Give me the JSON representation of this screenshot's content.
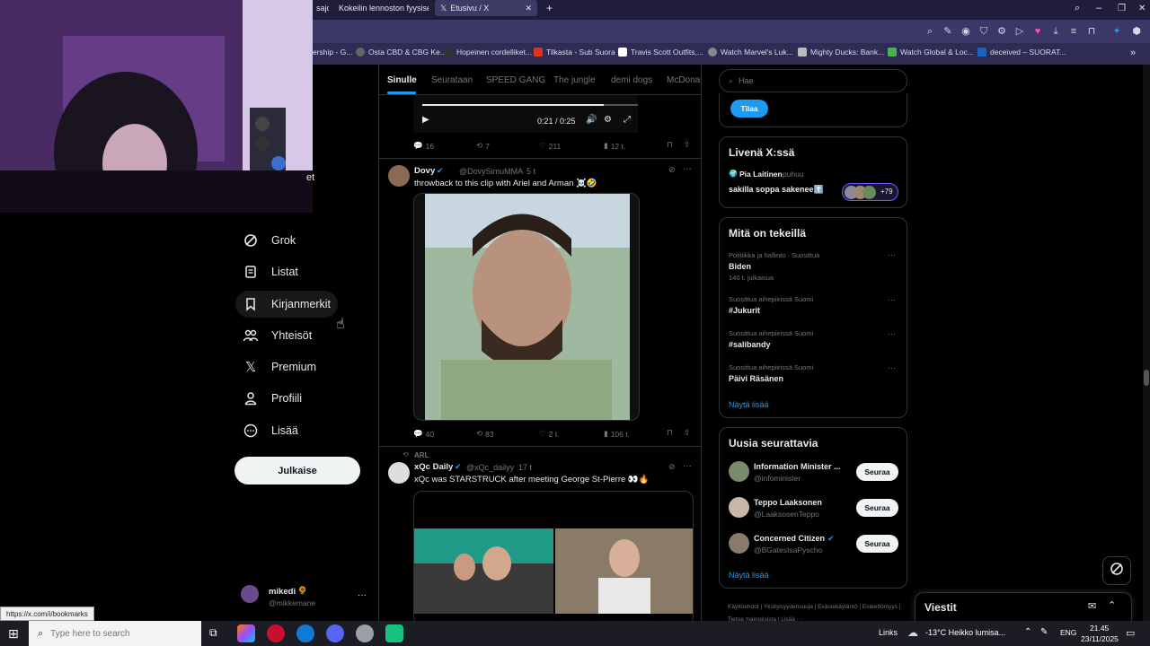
{
  "browser": {
    "tabs": [
      {
        "label": "sajo"
      },
      {
        "label": "Kokeilin lennoston fyysise"
      },
      {
        "label": "Etusivu / X"
      }
    ],
    "bookmarks": [
      "ership - G...",
      "Osta CBD & CBG Ke...",
      "Hopeinen cordelliket...",
      "Tilkasta - Sub Suora",
      "Travis Scott Outfits,...",
      "Watch Marvel's Luk...",
      "Mighty Ducks: Bank...",
      "Watch Global & Loc...",
      "deceived – SUORAT..."
    ]
  },
  "nav": {
    "partial_top": "et",
    "items": [
      {
        "label": "Grok",
        "icon": "grok-icon"
      },
      {
        "label": "Listat",
        "icon": "list-icon"
      },
      {
        "label": "Kirjanmerkit",
        "icon": "bookmark-icon"
      },
      {
        "label": "Yhteisöt",
        "icon": "communities-icon"
      },
      {
        "label": "Premium",
        "icon": "x-logo-icon"
      },
      {
        "label": "Profiili",
        "icon": "profile-icon"
      },
      {
        "label": "Lisää",
        "icon": "more-circle-icon"
      }
    ],
    "post_button": "Julkaise",
    "account": {
      "name": "mikedi",
      "handle": "@mikkemane"
    },
    "status_url": "https://x.com/i/bookmarks"
  },
  "feed": {
    "tabs": [
      "Sinulle",
      "Seurataan",
      "SPEED GANG",
      "The jungle",
      "demi dogs",
      "McDonal"
    ],
    "video_time": "0:21 / 0:25",
    "tweet0_actions": {
      "replies": "16",
      "reposts": "7",
      "likes": "211",
      "views": "12 t."
    },
    "tweet1": {
      "name": "Dovy",
      "handle": "@DovySimuMMA",
      "time": "5 t",
      "text": "throwback to this clip with Ariel and Arman ☠️🤣",
      "replies": "40",
      "reposts": "83",
      "likes": "2 t.",
      "views": "106 t."
    },
    "tweet2": {
      "reposted_by": "ARL",
      "name": "xQc Daily",
      "handle": "@xQc_dailyy",
      "time": "17 t",
      "text": "xQc was STARSTRUCK after meeting George St-Pierre 👀🔥"
    }
  },
  "right": {
    "search_placeholder": "Hae",
    "subscribe_button": "Tilaa",
    "live": {
      "title": "Livenä X:ssä",
      "host": "Pia Laitinen",
      "host_suffix": "puhuu",
      "stream_title": "sakilla soppa sakenee⬆️",
      "count": "+79"
    },
    "trends": {
      "title": "Mitä on tekeillä",
      "items": [
        {
          "category": "Politiikka ja hallinto · Suosittua",
          "name": "Biden",
          "posts": "140 t. julkaisua"
        },
        {
          "category": "Suosittua aihepiirissä Suomi",
          "name": "#Jukurit",
          "posts": ""
        },
        {
          "category": "Suosittua aihepiirissä Suomi",
          "name": "#salibandy",
          "posts": ""
        },
        {
          "category": "Suosittua aihepiirissä Suomi",
          "name": "Päivi Räsänen",
          "posts": ""
        }
      ],
      "show_more": "Näytä lisää"
    },
    "follow": {
      "title": "Uusia seurattavia",
      "items": [
        {
          "name": "Information Minister ...",
          "handle": "@infominister"
        },
        {
          "name": "Teppo Laaksonen",
          "handle": "@LaaksosenTeppo"
        },
        {
          "name": "Concerned Citizen",
          "handle": "@BGatesIsaPyscho"
        }
      ],
      "button": "Seuraa",
      "show_more": "Näytä lisää"
    },
    "footer": [
      "Käyttöehdot",
      "Yksityisyydensuoja",
      "Evästekäytäntö",
      "Esteettömyys",
      "Tietoa mainoksista",
      "Lisää ···"
    ],
    "messages_title": "Viestit"
  },
  "taskbar": {
    "search_placeholder": "Type here to search",
    "links": "Links",
    "weather": "-13°C  Heikko lumisa...",
    "lang": "ENG",
    "time": "21.45",
    "date": "23/11/2025"
  },
  "colors": {
    "accent": "#1d9bf0",
    "chrome": "#3b3868",
    "background": "#000000"
  }
}
